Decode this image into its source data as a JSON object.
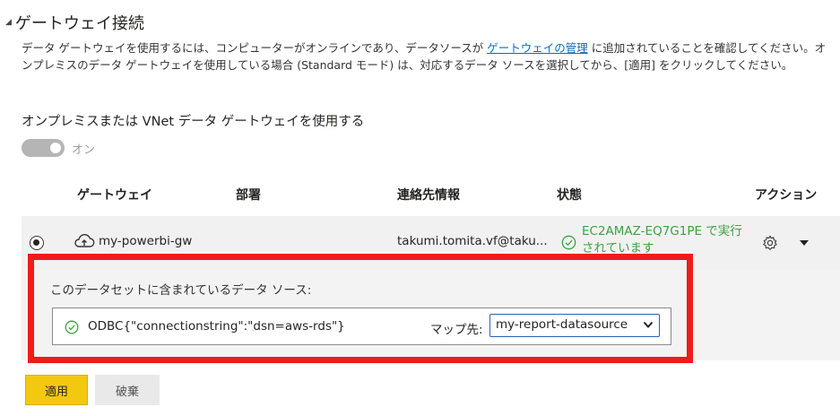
{
  "section": {
    "title": "ゲートウェイ接続",
    "caret_icon": "triangle-down-icon"
  },
  "description": {
    "part1": "データ ゲートウェイを使用するには、コンピューターがオンラインであり、データソースが ",
    "link": "ゲートウェイの管理",
    "part2": " に追加されていることを確認してください。オンプレミスのデータ ゲートウェイを使用している場合 (Standard モード) は、対応するデータ ソースを選択してから、[適用] をクリックしてください。"
  },
  "toggle": {
    "label": "オンプレミスまたは VNet データ ゲートウェイを使用する",
    "state": "オン",
    "on": true
  },
  "table": {
    "headers": {
      "gateway": "ゲートウェイ",
      "department": "部署",
      "contact": "連絡先情報",
      "status": "状態",
      "action": "アクション"
    },
    "row": {
      "name": "my-powerbi-gw",
      "contact": "takumi.tomita.vf@taku...",
      "status": "EC2AMAZ-EQ7G1PE で実行されています",
      "selected": true
    }
  },
  "datasources": {
    "title": "このデータセットに含まれているデータ ソース:",
    "connection": "ODBC{\"connectionstring\":\"dsn=aws-rds\"}",
    "map_label": "マップ先:",
    "selected_value": "my-report-datasource"
  },
  "buttons": {
    "apply": "適用",
    "discard": "破棄"
  },
  "colors": {
    "accent_yellow": "#f2c811",
    "status_green": "#3da33f",
    "highlight_red": "#ee1c1c",
    "link_blue": "#0f6cbd"
  }
}
